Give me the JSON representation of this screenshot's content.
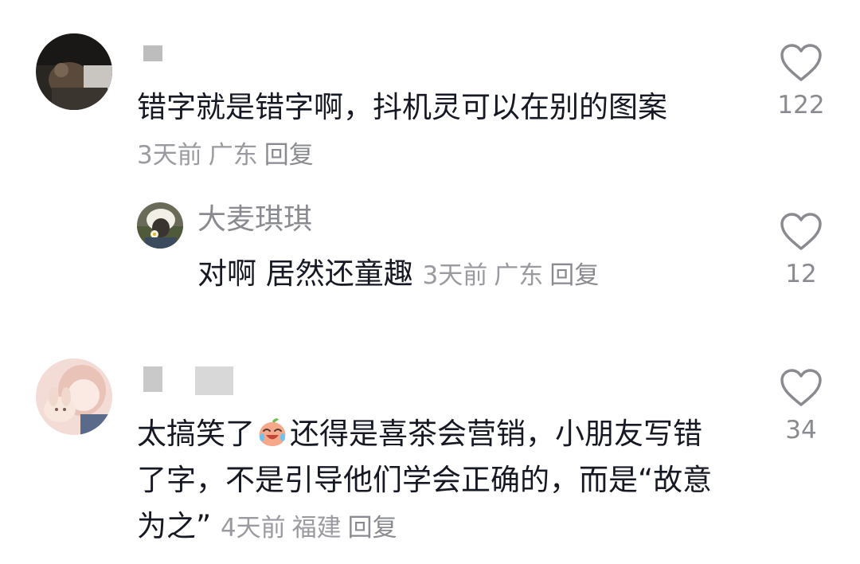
{
  "comments": [
    {
      "username": "",
      "text": "错字就是错字啊，抖机灵可以在别的图案",
      "time": "3天前",
      "location": "广东",
      "reply_label": "回复",
      "likes": "122"
    },
    {
      "username": "大麦琪琪",
      "text": "对啊 居然还童趣",
      "time": "3天前",
      "location": "广东",
      "reply_label": "回复",
      "likes": "12"
    },
    {
      "username": "",
      "text_before_emoji": "太搞笑了",
      "emoji": "crying-laughing-peach-emoji",
      "text_after_emoji": "还得是喜茶会营销，小朋友写错了字，不是引导他们学会正确的，而是“故意为之”",
      "time": "4天前",
      "location": "福建",
      "reply_label": "回复",
      "likes": "34"
    }
  ],
  "colors": {
    "text": "#161823",
    "meta": "#9a9ba0",
    "heart_stroke": "#8a8b91"
  }
}
